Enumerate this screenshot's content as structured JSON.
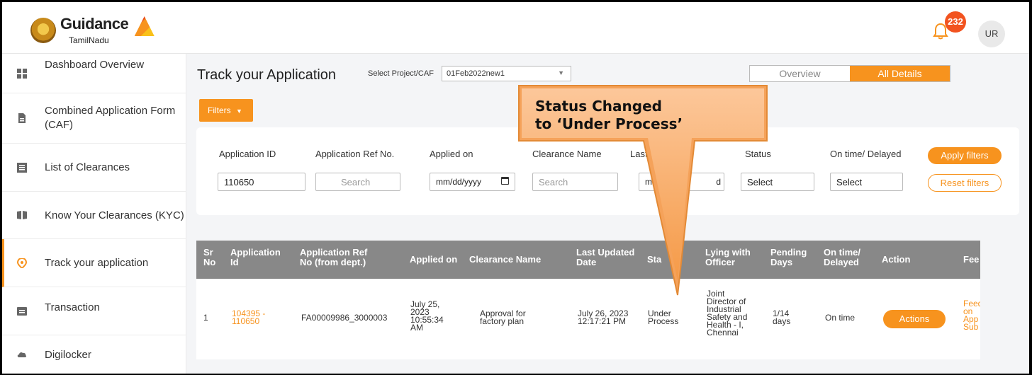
{
  "header": {
    "brand_main": "Guidance",
    "brand_sub": "TamilNadu",
    "notification_count": "232",
    "avatar_initials": "UR"
  },
  "sidebar": {
    "items": [
      {
        "label": "Dashboard Overview"
      },
      {
        "label": "Combined Application Form (CAF)"
      },
      {
        "label": "List of Clearances"
      },
      {
        "label": "Know Your Clearances (KYC)"
      },
      {
        "label": "Track your application"
      },
      {
        "label": "Transaction"
      },
      {
        "label": "Digilocker"
      }
    ]
  },
  "main": {
    "title": "Track your Application",
    "project_label": "Select Project/CAF",
    "project_value": "01Feb2022new1",
    "tabs": [
      {
        "label": "Overview"
      },
      {
        "label": "All Details"
      }
    ],
    "filters_button": "Filters"
  },
  "filters": {
    "labels": {
      "app_id": "Application ID",
      "ref_no": "Application Ref No.",
      "applied_on": "Applied on",
      "clearance": "Clearance Name",
      "last_updated": "Last U",
      "status": "Status",
      "on_time": "On time/ Delayed"
    },
    "app_id_value": "110650",
    "ref_no_placeholder": "Search",
    "applied_on_placeholder": "mm/dd/yyyy",
    "clearance_placeholder": "Search",
    "last_updated_placeholder": "mm/d",
    "last_updated_suffix": "d",
    "status_placeholder": "Select",
    "on_time_placeholder": "Select",
    "apply_button": "Apply filters",
    "reset_button": "Reset filters"
  },
  "table": {
    "headers": {
      "sr1": "Sr",
      "sr2": "No",
      "app1": "Application",
      "app2": "Id",
      "ref1": "Application Ref",
      "ref2": "No (from dept.)",
      "applied": "Applied on",
      "clearance": "Clearance Name",
      "updated1": "Last Updated",
      "updated2": "Date",
      "status": "Sta",
      "lying1": "Lying with",
      "lying2": "Officer",
      "pending1": "Pending",
      "pending2": "Days",
      "ontime1": "On time/",
      "ontime2": "Delayed",
      "action": "Action",
      "fee": "Fee"
    },
    "row": {
      "sr": "1",
      "app_id_1": "104395 -",
      "app_id_2": "110650",
      "ref": "FA00009986_3000003",
      "applied_1": "July 25,",
      "applied_2": "2023",
      "applied_3": "10:55:34",
      "applied_4": "AM",
      "clearance_1": "Approval for",
      "clearance_2": "factory plan",
      "updated_1": "July 26, 2023",
      "updated_2": "12:17:21 PM",
      "status_1": "Under",
      "status_2": "Process",
      "lying_1": "Joint",
      "lying_2": "Director of",
      "lying_3": "Industrial",
      "lying_4": "Safety and",
      "lying_5": "Health - I,",
      "lying_6": "Chennai",
      "pending_1": "1/14",
      "pending_2": "days",
      "ontime": "On time",
      "action": "Actions",
      "fee_1": "Feed",
      "fee_2": "on",
      "fee_3": "App",
      "fee_4": "Sub"
    }
  },
  "callout": {
    "line1": "Status Changed",
    "line2": "to ‘Under Process’"
  },
  "colors": {
    "accent": "#f7931e",
    "header_row": "#888888",
    "badge": "#f2531f"
  }
}
